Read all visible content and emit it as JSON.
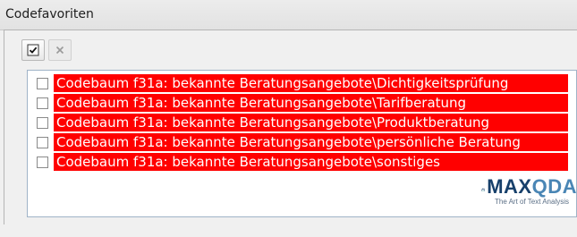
{
  "window": {
    "title": "Codefavoriten"
  },
  "toolbar": {
    "buttons": [
      {
        "icon": "checkbox-checked-icon",
        "enabled": true
      },
      {
        "icon": "close-icon",
        "enabled": false
      }
    ]
  },
  "favorites": {
    "items": [
      {
        "label": "Codebaum f31a: bekannte Beratungsangebote\\Dichtigkeitsprüfung",
        "checked": false,
        "color": "#ff0000"
      },
      {
        "label": "Codebaum f31a: bekannte Beratungsangebote\\Tarifberatung",
        "checked": false,
        "color": "#ff0000"
      },
      {
        "label": "Codebaum f31a: bekannte Beratungsangebote\\Produktberatung",
        "checked": false,
        "color": "#ff0000"
      },
      {
        "label": "Codebaum f31a: bekannte Beratungsangebote\\persönliche Beratung",
        "checked": false,
        "color": "#ff0000"
      },
      {
        "label": "Codebaum f31a: bekannte Beratungsangebote\\sonstiges",
        "checked": false,
        "color": "#ff0000"
      }
    ]
  },
  "logo": {
    "brand_main": "MAX",
    "brand_accent": "QDA",
    "tagline": "The Art of Text Analysis"
  }
}
